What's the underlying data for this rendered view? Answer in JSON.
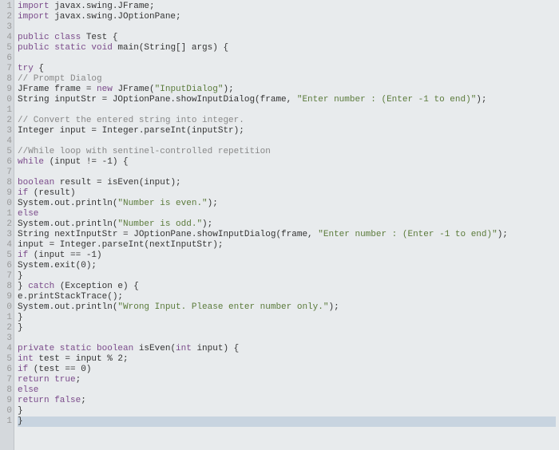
{
  "gutter": [
    "1",
    "2",
    "3",
    "4",
    "5",
    "6",
    "7",
    "8",
    "9",
    "0",
    "1",
    "2",
    "3",
    "4",
    "5",
    "6",
    "7",
    "8",
    "9",
    "0",
    "1",
    "2",
    "3",
    "4",
    "5",
    "6",
    "7",
    "8",
    "9",
    "0",
    "1",
    "2",
    "3",
    "4",
    "5",
    "6",
    "7",
    "8",
    "9",
    "0",
    "1"
  ],
  "code_lines": [
    {
      "k": "import",
      "t1": " javax.swing.JFrame;"
    },
    {
      "k": "import",
      "t1": " javax.swing.JOptionPane;"
    },
    {
      "blank": true
    },
    {
      "k": "public class",
      "t1": " Test {"
    },
    {
      "k": "public static void",
      "t1": " main(String[] args) {"
    },
    {
      "blank": true
    },
    {
      "k": "try",
      "t1": " {"
    },
    {
      "com": "// Prompt Dialog"
    },
    {
      "t0": "JFrame frame = ",
      "k": "new",
      "t1": " JFrame(",
      "s": "\"InputDialog\"",
      "t2": ");"
    },
    {
      "t0": "String inputStr = JOptionPane.showInputDialog(frame, ",
      "s": "\"Enter number : (Enter -1 to end)\"",
      "t2": ");"
    },
    {
      "blank": true
    },
    {
      "com": "// Convert the entered string into integer."
    },
    {
      "t0": "Integer input = Integer.parseInt(inputStr);"
    },
    {
      "blank": true
    },
    {
      "com": "//While loop with sentinel-controlled repetition"
    },
    {
      "k": "while",
      "t1": " (input != -1) {"
    },
    {
      "blank": true
    },
    {
      "k": "boolean",
      "t1": " result = isEven(input);"
    },
    {
      "k": "if",
      "t1": " (result)"
    },
    {
      "t0": "System.out.println(",
      "s": "\"Number is even.\"",
      "t2": ");"
    },
    {
      "k": "else",
      "t1": ""
    },
    {
      "t0": "System.out.println(",
      "s": "\"Number is odd.\"",
      "t2": ");"
    },
    {
      "t0": "String nextInputStr = JOptionPane.showInputDialog(frame, ",
      "s": "\"Enter number : (Enter -1 to end)\"",
      "t2": ");"
    },
    {
      "t0": "input = Integer.parseInt(nextInputStr);"
    },
    {
      "k": "if",
      "t1": " (input == -1)"
    },
    {
      "t0": "System.exit(0);"
    },
    {
      "t0": "}"
    },
    {
      "t0": "} ",
      "k": "catch",
      "t1": " (Exception e) {"
    },
    {
      "t0": "e.printStackTrace();"
    },
    {
      "t0": "System.out.println(",
      "s": "\"Wrong Input. Please enter number only.\"",
      "t2": ");"
    },
    {
      "t0": "}"
    },
    {
      "t0": "}"
    },
    {
      "blank": true
    },
    {
      "k": "private static boolean",
      "t1": " isEven(",
      "k2": "int",
      "t2": " input) {"
    },
    {
      "k": "int",
      "t1": " test = input % 2;"
    },
    {
      "k": "if",
      "t1": " (test == 0)"
    },
    {
      "k": "return true",
      "t1": ";"
    },
    {
      "k": "else",
      "t1": ""
    },
    {
      "k": "return false",
      "t1": ";"
    },
    {
      "t0": "}"
    },
    {
      "t0": "}",
      "hl": true
    }
  ]
}
